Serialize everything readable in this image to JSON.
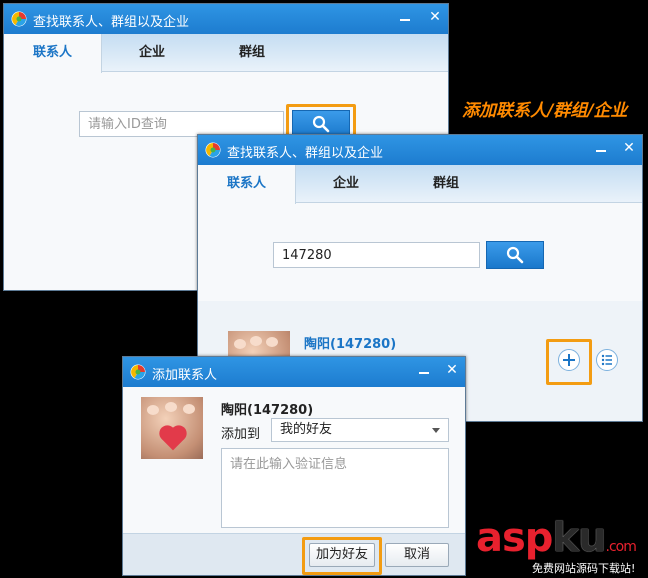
{
  "banner_text": "添加联系人/群组/企业",
  "window1": {
    "title": "查找联系人、群组以及企业",
    "tabs": [
      "联系人",
      "企业",
      "群组"
    ],
    "search_placeholder": "请输入ID查询"
  },
  "window2": {
    "title": "查找联系人、群组以及企业",
    "tabs": [
      "联系人",
      "企业",
      "群组"
    ],
    "search_value": "147280",
    "result_name": "陶阳(147280)"
  },
  "dialog": {
    "title": "添加联系人",
    "contact_name": "陶阳(147280)",
    "add_to_label": "添加到",
    "group_value": "我的好友",
    "verify_placeholder": "请在此输入验证信息",
    "confirm_label": "加为好友",
    "cancel_label": "取消"
  },
  "watermark": {
    "logo_red": "asp",
    "logo_dark": "ku",
    "logo_suffix": ".com",
    "tagline": "免费网站源码下载站!"
  },
  "colors": {
    "accent": "#1b75c6",
    "highlight": "#f39c12",
    "titlebar": "#2188d8"
  }
}
